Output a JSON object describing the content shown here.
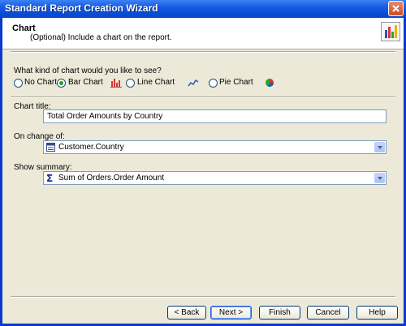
{
  "window": {
    "title": "Standard Report Creation Wizard"
  },
  "header": {
    "title": "Chart",
    "subtitle": "(Optional) Include a chart on the report."
  },
  "chart_type": {
    "question": "What kind of chart would you like to see?",
    "options": [
      {
        "label": "No Chart",
        "selected": false
      },
      {
        "label": "Bar Chart",
        "selected": true
      },
      {
        "label": "Line Chart",
        "selected": false
      },
      {
        "label": "Pie Chart",
        "selected": false
      }
    ]
  },
  "chart_title": {
    "label": "Chart title:",
    "value": "Total Order Amounts by Country"
  },
  "on_change_of": {
    "label": "On change of:",
    "value": "Customer.Country"
  },
  "show_summary": {
    "label": "Show summary:",
    "value": "Sum of Orders.Order Amount"
  },
  "buttons": {
    "back": "< Back",
    "next": "Next >",
    "finish": "Finish",
    "cancel": "Cancel",
    "help": "Help"
  },
  "colors": {
    "titlebar": "#0a50d8",
    "client": "#ece9d8",
    "radio_selected": "#21a121"
  }
}
